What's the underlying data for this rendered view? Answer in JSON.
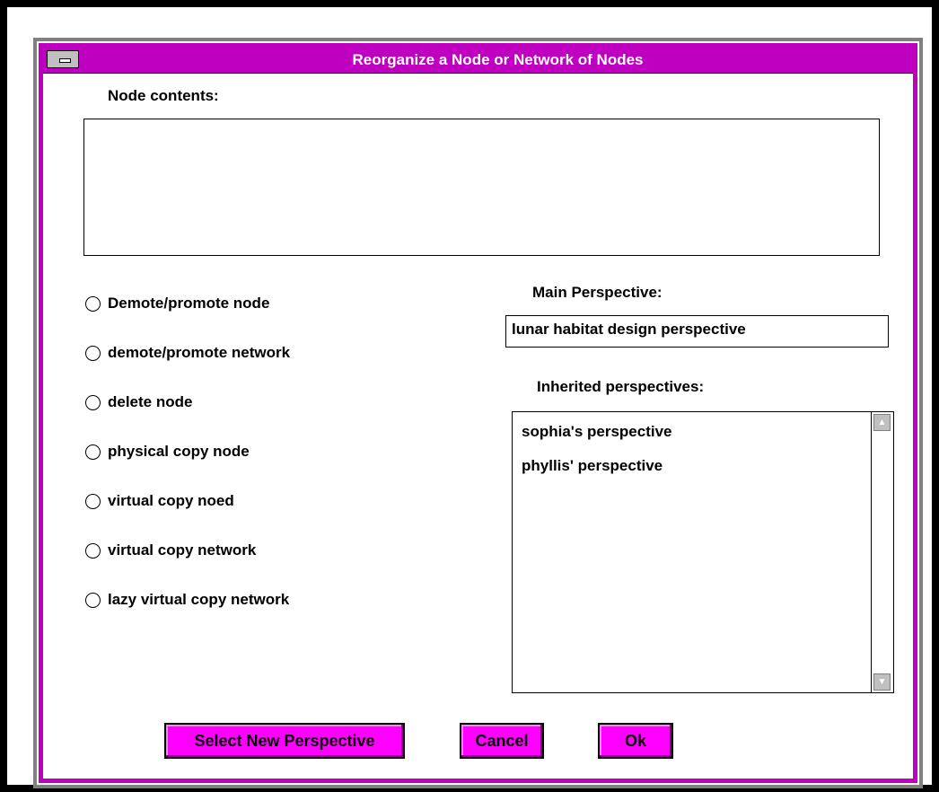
{
  "window": {
    "title": "Reorganize a Node or Network of Nodes"
  },
  "node_contents": {
    "label": "Node contents:",
    "value": ""
  },
  "options": [
    {
      "label": "Demote/promote node",
      "selected": false
    },
    {
      "label": "demote/promote network",
      "selected": false
    },
    {
      "label": "delete node",
      "selected": false
    },
    {
      "label": "physical copy node",
      "selected": false
    },
    {
      "label": "virtual copy noed",
      "selected": false
    },
    {
      "label": "virtual copy network",
      "selected": false
    },
    {
      "label": "lazy virtual copy network",
      "selected": false
    }
  ],
  "main_perspective": {
    "label": "Main Perspective:",
    "value": "lunar habitat design perspective"
  },
  "inherited": {
    "label": "Inherited perspectives:",
    "items": [
      "sophia's perspective",
      "phyllis' perspective"
    ]
  },
  "buttons": {
    "select_new": "Select New Perspective",
    "cancel": "Cancel",
    "ok": "Ok"
  },
  "colors": {
    "accent": "#c000c0",
    "button": "#ff00ff"
  },
  "icons": {
    "scroll_up": "up-arrow-icon",
    "scroll_down": "down-arrow-icon",
    "system_menu": "system-menu-icon"
  }
}
